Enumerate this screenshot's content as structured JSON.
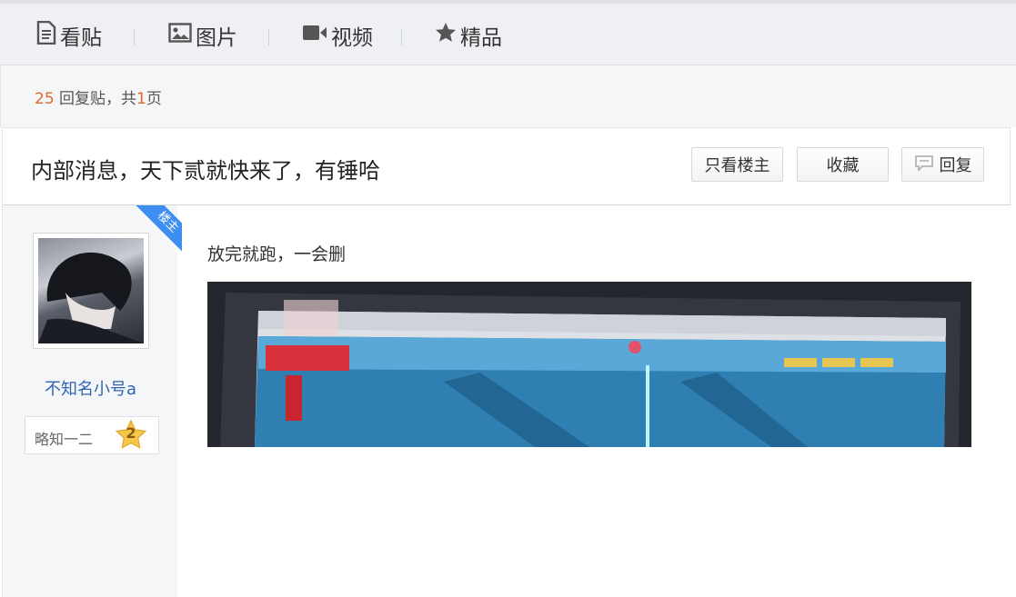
{
  "tabs": [
    {
      "label": "看贴",
      "icon": "document-icon"
    },
    {
      "label": "图片",
      "icon": "image-icon"
    },
    {
      "label": "视频",
      "icon": "video-camera-icon"
    },
    {
      "label": "精品",
      "icon": "star-icon"
    }
  ],
  "summary": {
    "reply_count": "25",
    "reply_text": " 回复贴，共",
    "page_count": "1",
    "page_suffix": "页"
  },
  "thread": {
    "title": "内部消息，天下贰就快来了，有锤哈",
    "buttons": {
      "only_author": "只看楼主",
      "favorite": "收藏",
      "reply": "回复"
    }
  },
  "post": {
    "author_badge": "楼主",
    "username": "不知名小号a",
    "level_title": "略知一二",
    "level_number": "2",
    "content": "放完就跑，一会删"
  },
  "colors": {
    "accent_orange": "#e0692a",
    "link_blue": "#2d64b3",
    "badge_blue": "#3d8ef0"
  }
}
